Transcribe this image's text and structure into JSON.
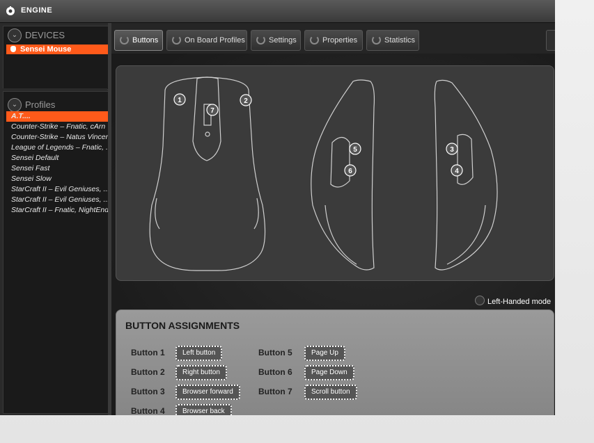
{
  "app": {
    "title": "ENGINE"
  },
  "devices": {
    "header": "DEVICES",
    "items": [
      "Sensei Mouse"
    ]
  },
  "profiles": {
    "header": "Profiles",
    "items": [
      "A.T....",
      "Counter-Strike – Fnatic, cArn",
      "Counter-Strike – Natus Vincere",
      "League of Legends – Fnatic, ...",
      "Sensei Default",
      "Sensei Fast",
      "Sensei Slow",
      "StarCraft II – Evil Geniuses, ...",
      "StarCraft II – Evil Geniuses, ...",
      "StarCraft II – Fnatic, NightEnd"
    ]
  },
  "tabs": [
    "Buttons",
    "On Board Profiles",
    "Settings",
    "Properties",
    "Statistics"
  ],
  "mouse": {
    "labels": [
      "1",
      "2",
      "7",
      "5",
      "6",
      "3",
      "4"
    ]
  },
  "left_handed": "Left-Handed mode",
  "assignments": {
    "title": "BUTTON ASSIGNMENTS",
    "buttons": [
      {
        "label": "Button 1",
        "value": "Left button"
      },
      {
        "label": "Button 2",
        "value": "Right button"
      },
      {
        "label": "Button 3",
        "value": "Browser forward"
      },
      {
        "label": "Button 4",
        "value": "Browser back"
      },
      {
        "label": "Button 5",
        "value": "Page Up"
      },
      {
        "label": "Button 6",
        "value": "Page Down"
      },
      {
        "label": "Button 7",
        "value": "Scroll button"
      }
    ]
  }
}
